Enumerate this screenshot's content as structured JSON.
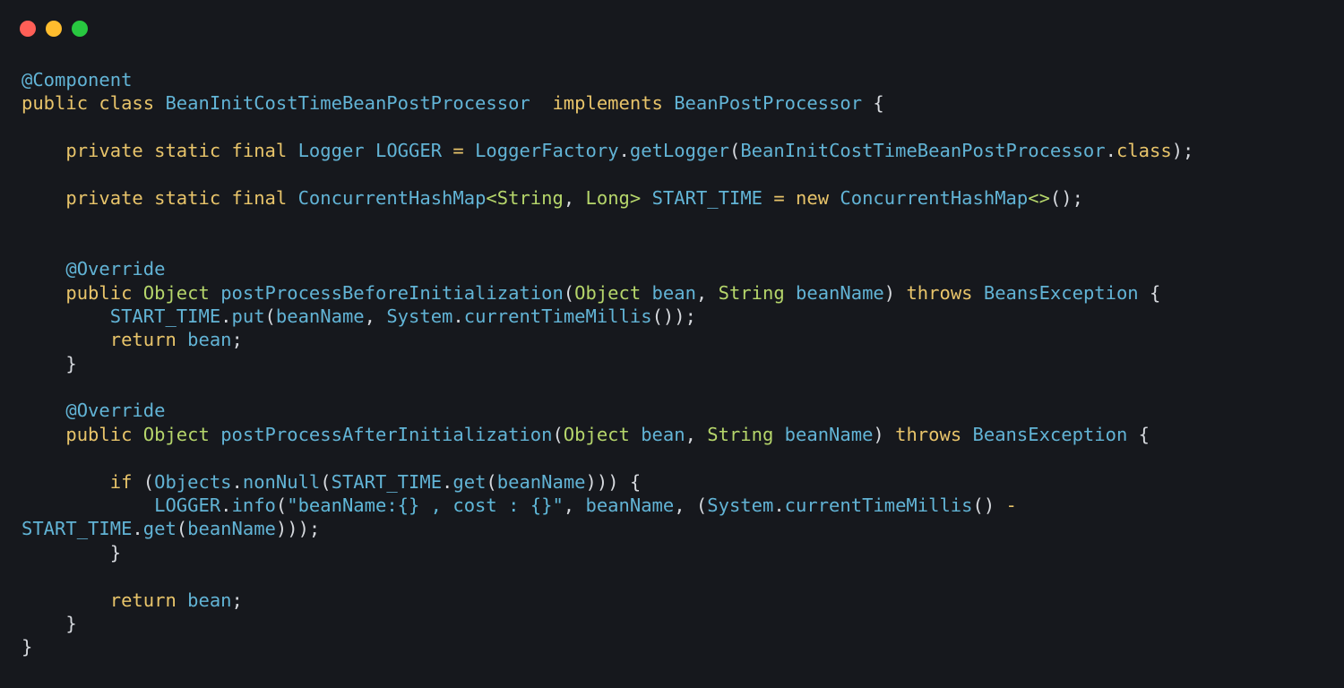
{
  "window": {
    "controls": [
      {
        "name": "close-button",
        "color": "#ff5f57"
      },
      {
        "name": "minimize-button",
        "color": "#febc2e"
      },
      {
        "name": "maximize-button",
        "color": "#28c840"
      }
    ]
  },
  "code": {
    "lines": [
      [
        {
          "t": "@Component",
          "c": "annotation"
        }
      ],
      [
        {
          "t": "public",
          "c": "keyword"
        },
        {
          "t": " ",
          "c": "plain"
        },
        {
          "t": "class",
          "c": "keyword"
        },
        {
          "t": " ",
          "c": "plain"
        },
        {
          "t": "BeanInitCostTimeBeanPostProcessor",
          "c": "class"
        },
        {
          "t": "  ",
          "c": "plain"
        },
        {
          "t": "implements",
          "c": "keyword"
        },
        {
          "t": " ",
          "c": "plain"
        },
        {
          "t": "BeanPostProcessor",
          "c": "class"
        },
        {
          "t": " {",
          "c": "plain"
        }
      ],
      [],
      [
        {
          "t": "    ",
          "c": "plain"
        },
        {
          "t": "private",
          "c": "keyword"
        },
        {
          "t": " ",
          "c": "plain"
        },
        {
          "t": "static",
          "c": "keyword"
        },
        {
          "t": " ",
          "c": "plain"
        },
        {
          "t": "final",
          "c": "keyword"
        },
        {
          "t": " ",
          "c": "plain"
        },
        {
          "t": "Logger",
          "c": "type"
        },
        {
          "t": " ",
          "c": "plain"
        },
        {
          "t": "LOGGER",
          "c": "field"
        },
        {
          "t": " = ",
          "c": "operator"
        },
        {
          "t": "LoggerFactory",
          "c": "class"
        },
        {
          "t": ".",
          "c": "plain"
        },
        {
          "t": "getLogger",
          "c": "method"
        },
        {
          "t": "(",
          "c": "plain"
        },
        {
          "t": "BeanInitCostTimeBeanPostProcessor",
          "c": "class"
        },
        {
          "t": ".",
          "c": "plain"
        },
        {
          "t": "class",
          "c": "keyword"
        },
        {
          "t": ");",
          "c": "plain"
        }
      ],
      [],
      [
        {
          "t": "    ",
          "c": "plain"
        },
        {
          "t": "private",
          "c": "keyword"
        },
        {
          "t": " ",
          "c": "plain"
        },
        {
          "t": "static",
          "c": "keyword"
        },
        {
          "t": " ",
          "c": "plain"
        },
        {
          "t": "final",
          "c": "keyword"
        },
        {
          "t": " ",
          "c": "plain"
        },
        {
          "t": "ConcurrentHashMap",
          "c": "type"
        },
        {
          "t": "<String",
          "c": "generic"
        },
        {
          "t": ", ",
          "c": "plain"
        },
        {
          "t": "Long>",
          "c": "generic"
        },
        {
          "t": " ",
          "c": "plain"
        },
        {
          "t": "START_TIME",
          "c": "field"
        },
        {
          "t": " = ",
          "c": "operator"
        },
        {
          "t": "new",
          "c": "keyword"
        },
        {
          "t": " ",
          "c": "plain"
        },
        {
          "t": "ConcurrentHashMap",
          "c": "type"
        },
        {
          "t": "<>",
          "c": "generic"
        },
        {
          "t": "();",
          "c": "plain"
        }
      ],
      [],
      [],
      [
        {
          "t": "    ",
          "c": "plain"
        },
        {
          "t": "@Override",
          "c": "annotation"
        }
      ],
      [
        {
          "t": "    ",
          "c": "plain"
        },
        {
          "t": "public",
          "c": "keyword"
        },
        {
          "t": " ",
          "c": "plain"
        },
        {
          "t": "Object",
          "c": "generic"
        },
        {
          "t": " ",
          "c": "plain"
        },
        {
          "t": "postProcessBeforeInitialization",
          "c": "method"
        },
        {
          "t": "(",
          "c": "plain"
        },
        {
          "t": "Object",
          "c": "generic"
        },
        {
          "t": " ",
          "c": "plain"
        },
        {
          "t": "bean",
          "c": "ident"
        },
        {
          "t": ", ",
          "c": "plain"
        },
        {
          "t": "String",
          "c": "generic"
        },
        {
          "t": " ",
          "c": "plain"
        },
        {
          "t": "beanName",
          "c": "ident"
        },
        {
          "t": ") ",
          "c": "plain"
        },
        {
          "t": "throws",
          "c": "keyword"
        },
        {
          "t": " ",
          "c": "plain"
        },
        {
          "t": "BeansException",
          "c": "class"
        },
        {
          "t": " {",
          "c": "plain"
        }
      ],
      [
        {
          "t": "        ",
          "c": "plain"
        },
        {
          "t": "START_TIME",
          "c": "field"
        },
        {
          "t": ".",
          "c": "plain"
        },
        {
          "t": "put",
          "c": "method"
        },
        {
          "t": "(",
          "c": "plain"
        },
        {
          "t": "beanName",
          "c": "ident"
        },
        {
          "t": ", ",
          "c": "plain"
        },
        {
          "t": "System",
          "c": "class"
        },
        {
          "t": ".",
          "c": "plain"
        },
        {
          "t": "currentTimeMillis",
          "c": "method"
        },
        {
          "t": "());",
          "c": "plain"
        }
      ],
      [
        {
          "t": "        ",
          "c": "plain"
        },
        {
          "t": "return",
          "c": "keyword"
        },
        {
          "t": " ",
          "c": "plain"
        },
        {
          "t": "bean",
          "c": "ident"
        },
        {
          "t": ";",
          "c": "plain"
        }
      ],
      [
        {
          "t": "    }",
          "c": "plain"
        }
      ],
      [],
      [
        {
          "t": "    ",
          "c": "plain"
        },
        {
          "t": "@Override",
          "c": "annotation"
        }
      ],
      [
        {
          "t": "    ",
          "c": "plain"
        },
        {
          "t": "public",
          "c": "keyword"
        },
        {
          "t": " ",
          "c": "plain"
        },
        {
          "t": "Object",
          "c": "generic"
        },
        {
          "t": " ",
          "c": "plain"
        },
        {
          "t": "postProcessAfterInitialization",
          "c": "method"
        },
        {
          "t": "(",
          "c": "plain"
        },
        {
          "t": "Object",
          "c": "generic"
        },
        {
          "t": " ",
          "c": "plain"
        },
        {
          "t": "bean",
          "c": "ident"
        },
        {
          "t": ", ",
          "c": "plain"
        },
        {
          "t": "String",
          "c": "generic"
        },
        {
          "t": " ",
          "c": "plain"
        },
        {
          "t": "beanName",
          "c": "ident"
        },
        {
          "t": ") ",
          "c": "plain"
        },
        {
          "t": "throws",
          "c": "keyword"
        },
        {
          "t": " ",
          "c": "plain"
        },
        {
          "t": "BeansException",
          "c": "class"
        },
        {
          "t": " {",
          "c": "plain"
        }
      ],
      [],
      [
        {
          "t": "        ",
          "c": "plain"
        },
        {
          "t": "if",
          "c": "keyword"
        },
        {
          "t": " (",
          "c": "plain"
        },
        {
          "t": "Objects",
          "c": "class"
        },
        {
          "t": ".",
          "c": "plain"
        },
        {
          "t": "nonNull",
          "c": "method"
        },
        {
          "t": "(",
          "c": "plain"
        },
        {
          "t": "START_TIME",
          "c": "field"
        },
        {
          "t": ".",
          "c": "plain"
        },
        {
          "t": "get",
          "c": "method"
        },
        {
          "t": "(",
          "c": "plain"
        },
        {
          "t": "beanName",
          "c": "ident"
        },
        {
          "t": "))) {",
          "c": "plain"
        }
      ],
      [
        {
          "t": "            ",
          "c": "plain"
        },
        {
          "t": "LOGGER",
          "c": "field"
        },
        {
          "t": ".",
          "c": "plain"
        },
        {
          "t": "info",
          "c": "method"
        },
        {
          "t": "(",
          "c": "plain"
        },
        {
          "t": "\"beanName:{} , cost : {}\"",
          "c": "string"
        },
        {
          "t": ", ",
          "c": "plain"
        },
        {
          "t": "beanName",
          "c": "ident"
        },
        {
          "t": ", (",
          "c": "plain"
        },
        {
          "t": "System",
          "c": "class"
        },
        {
          "t": ".",
          "c": "plain"
        },
        {
          "t": "currentTimeMillis",
          "c": "method"
        },
        {
          "t": "() ",
          "c": "plain"
        },
        {
          "t": "-",
          "c": "operator"
        }
      ],
      [
        {
          "t": "START_TIME",
          "c": "field"
        },
        {
          "t": ".",
          "c": "plain"
        },
        {
          "t": "get",
          "c": "method"
        },
        {
          "t": "(",
          "c": "plain"
        },
        {
          "t": "beanName",
          "c": "ident"
        },
        {
          "t": ")));",
          "c": "plain"
        }
      ],
      [
        {
          "t": "        }",
          "c": "plain"
        }
      ],
      [],
      [
        {
          "t": "        ",
          "c": "plain"
        },
        {
          "t": "return",
          "c": "keyword"
        },
        {
          "t": " ",
          "c": "plain"
        },
        {
          "t": "bean",
          "c": "ident"
        },
        {
          "t": ";",
          "c": "plain"
        }
      ],
      [
        {
          "t": "    }",
          "c": "plain"
        }
      ],
      [
        {
          "t": "}",
          "c": "plain"
        }
      ]
    ]
  }
}
